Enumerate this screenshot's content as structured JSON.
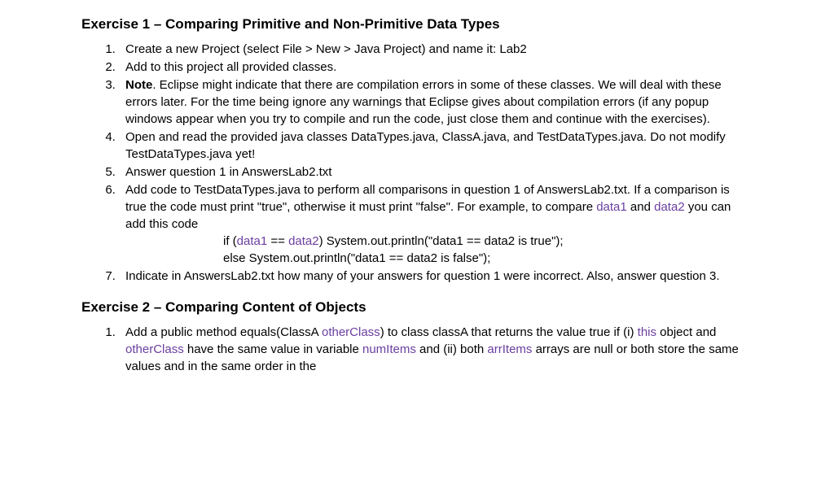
{
  "exercise1": {
    "heading": "Exercise 1 – Comparing Primitive and Non-Primitive Data Types",
    "items": {
      "i1": "Create a new Project (select File > New > Java Project) and name it: Lab2",
      "i2": "Add to this project all provided classes.",
      "i3": {
        "bold": "Note",
        "rest": ". Eclipse might indicate that there are compilation errors in some of these classes. We will deal with these errors later. For the time being ignore any warnings that Eclipse gives about compilation errors (if any popup windows appear when you try to compile and run the code, just close them and continue with the exercises)."
      },
      "i4": "Open and read the provided java classes DataTypes.java, ClassA.java, and TestDataTypes.java. Do not modify TestDataTypes.java yet!",
      "i5": "Answer question 1 in AnswersLab2.txt",
      "i6": {
        "a": "Add code to TestDataTypes.java to perform all comparisons in question 1 of AnswersLab2.txt. If a comparison is true the code must print \"true\", otherwise it must print \"false\". For example, to compare ",
        "d1": "data1",
        "b": " and ",
        "d2": "data2",
        "c": " you can add this code",
        "code1_a": "if (",
        "code1_d1": "data1",
        "code1_b": " == ",
        "code1_d2": "data2",
        "code1_c": ") System.out.println(\"data1 == data2 is true\");",
        "code2": "else System.out.println(\"data1 == data2 is false\");"
      },
      "i7": "Indicate in AnswersLab2.txt how many of your answers for question 1 were incorrect. Also, answer question 3."
    }
  },
  "exercise2": {
    "heading": "Exercise 2 – Comparing Content of Objects",
    "items": {
      "i1": {
        "a": "Add a public method equals(ClassA ",
        "p1": "otherClass",
        "b": ") to class classA that returns the value true if (i) ",
        "p2": "this",
        "c": " object and ",
        "p3": "otherClass",
        "d": " have the same value in variable ",
        "p4": "numItems",
        "e": " and (ii) both ",
        "p5": "arrItems",
        "f": " arrays are null or both store the same values and in the same order in the"
      }
    }
  }
}
